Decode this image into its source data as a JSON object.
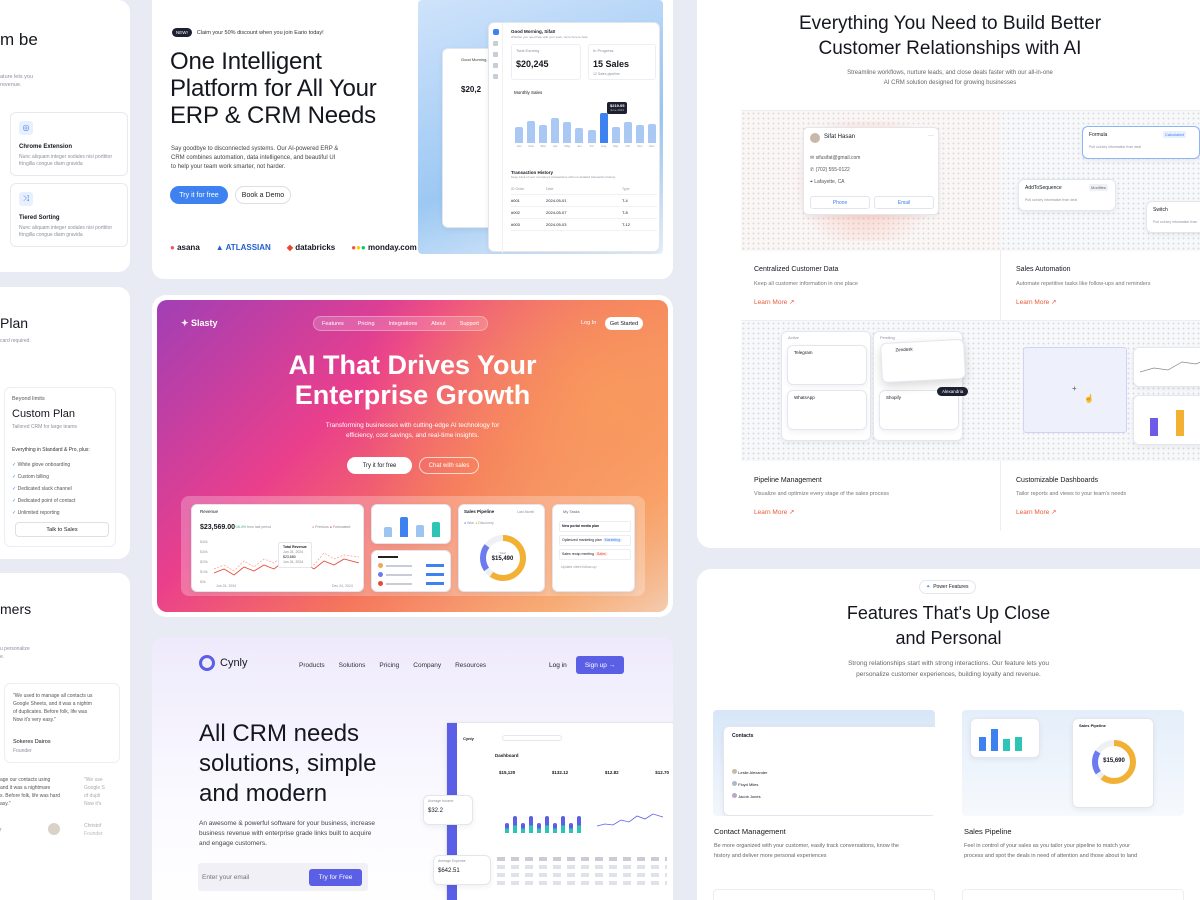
{
  "left_column": {
    "top": {
      "title_fragment": "m be",
      "text_lines": [
        "ature lets you",
        "revenue."
      ],
      "features": [
        {
          "title": "Chrome Extension",
          "desc_lines": [
            "Nunc aliquam integer sodales nisi porttitor",
            "fringilla congue diam gravida"
          ]
        },
        {
          "title": "Tiered Sorting",
          "desc_lines": [
            "Nunc aliquam integer sodales nisi porttitor",
            "fringilla congue diam gravida"
          ]
        }
      ]
    },
    "pricing": {
      "title_fragment": "Plan",
      "sub_fragment": "card required.",
      "eyebrow": "Beyond limits",
      "plan_name": "Custom Plan",
      "plan_desc": "Tailored CRM for large teams",
      "includes_label": "Everything in Standard & Pro, plus:",
      "items": [
        "White glove onboarding",
        "Custom billing",
        "Dedicated slack channel",
        "Dedicated point of contact",
        "Unlimited reporting"
      ],
      "cta": "Talk to Sales"
    },
    "testimonials": {
      "title_fragment": "mers",
      "sub_lines": [
        "u personalize",
        "e."
      ],
      "quote_lines": [
        "\"We used to manage all contacts us",
        "Google Sheets, and it was a nightm",
        "of duplicates. Before folk, life was",
        "Now it's very easy.\""
      ],
      "author": "Sokeres Dairos",
      "author_role": "Founder",
      "quote2_lines": [
        "age our contacts using",
        "and it was a nightmare",
        "s. Before folk, life was hard",
        "asy.\""
      ],
      "quote3_lines": [
        "\"We use",
        "Google S",
        "of dupli",
        "Now it's"
      ],
      "author3": "Christof",
      "role3": "Founder",
      "frag4": "r"
    }
  },
  "erp": {
    "badge": "NEW!",
    "announce": "Claim your 50% discount when you join Eario today!",
    "title_lines": [
      "One Intelligent",
      "Platform for All Your",
      "ERP & CRM Needs"
    ],
    "desc_lines": [
      "Say goodbye to disconnected systems. Our AI-powered ERP &",
      "CRM combines automation, data intelligence, and beautiful UI",
      "to help your team work smarter, not harder."
    ],
    "cta_primary": "Try it for free",
    "cta_secondary": "Book a Demo",
    "logos": [
      "asana",
      "ATLASSIAN",
      "databricks",
      "monday.com"
    ],
    "mockup": {
      "greeting": "Good Morning, Sifat!",
      "greeting_sub": "Whether you need help with your work, we're here to help",
      "total_earning_label": "Total Earning",
      "total_earning": "$20,245",
      "in_progress_label": "In Progress",
      "in_progress": "15 Sales",
      "in_progress_sub": "12 Sales pipeline",
      "monthly_sales": "Monthly Sales",
      "tooltip_value": "$219.05",
      "tooltip_sub": "June 2024",
      "bars": [
        0.55,
        0.75,
        0.6,
        0.85,
        0.7,
        0.5,
        0.45,
        1.0,
        0.55,
        0.7,
        0.6,
        0.65
      ],
      "months": [
        "Jan",
        "Feb",
        "Mar",
        "Apr",
        "May",
        "Jun",
        "Jul",
        "Aug",
        "Sep",
        "Oct",
        "Nov",
        "Dec"
      ],
      "tx_title": "Transaction History",
      "tx_sub": "Keep track of your company's transactions with our detailed transaction history.",
      "tx_headers": [
        "ID Order",
        "Date",
        "Type"
      ],
      "tx_rows": [
        [
          "#001",
          "2024-05-01",
          "T-4"
        ],
        [
          "#002",
          "2024-05-07",
          "T-8"
        ],
        [
          "#003",
          "2024-05-03",
          "T-12"
        ]
      ],
      "back_value": "$20,2"
    }
  },
  "slasty": {
    "logo": "Slasty",
    "nav": [
      "Features",
      "Pricing",
      "Integrations",
      "About",
      "Support"
    ],
    "login": "Log In",
    "get_started": "Get Started",
    "title_lines": [
      "AI That Drives Your",
      "Enterprise Growth"
    ],
    "desc_lines": [
      "Transforming businesses with cutting-edge AI technology for",
      "efficiency, cost savings, and real-time insights."
    ],
    "cta_primary": "Try it for free",
    "cta_secondary": "Chat with sales",
    "revenue_label": "Revenue",
    "revenue_value": "$23,569.00",
    "revenue_delta": "+16.4%",
    "revenue_delta_sub": "from last period",
    "legend_prev": "Previous",
    "legend_forecast": "Forecasted",
    "yticks": [
      "$40k",
      "$30k",
      "$20k",
      "$10k",
      "$0k"
    ],
    "date_start": "Jun 24, 2024",
    "date_end": "Dec 24, 2024",
    "tooltip_title": "Total Revenue",
    "tooltip_lines": [
      "Jun 24, 2024",
      "$23,680",
      "Jun 24, 2024"
    ],
    "pipeline_label": "Sales Pipeline",
    "pipeline_period": "Last Month",
    "pipeline_legend": [
      "Won",
      "Discovery"
    ],
    "pipeline_center_label": "Total",
    "pipeline_value": "$15,490",
    "tasks_label": "My Tasks",
    "tasks": [
      "New portal media plan",
      "Optimized marketing plan",
      "Sales recap meeting",
      "Update client follow-up"
    ],
    "task_tags": [
      "Marketing",
      "Sales"
    ]
  },
  "cynly": {
    "logo": "Cynly",
    "nav": [
      "Products",
      "Solutions",
      "Pricing",
      "Company",
      "Resources"
    ],
    "login": "Log in",
    "signup": "Sign up →",
    "title_lines": [
      "All CRM needs",
      "solutions, simple",
      "and modern"
    ],
    "desc_lines": [
      "An awesome & powerful software for your business, increase",
      "business revenue with enterprise grade links built to acquire",
      "and engage customers."
    ],
    "email_placeholder": "Enter your email",
    "cta": "Try for Free",
    "dash_title": "Dashboard",
    "stats": [
      "$15,120",
      "$132.12",
      "$12.82",
      "$12.70"
    ],
    "float1_label": "Average Income",
    "float1_value": "$32.2",
    "float2_label": "Average Expense",
    "float2_value": "$642.51"
  },
  "features_card": {
    "title_lines": [
      "Everything You Need to Build Better",
      "Customer Relationships with AI"
    ],
    "sub_lines": [
      "Streamline workflows, nurture leads, and close deals faster with our all-in-one",
      "AI CRM solution designed for growing businesses"
    ],
    "contact": {
      "name": "Sifat Hasan",
      "email": "sifusifat@gmail.com",
      "phone": "(702) 555-0122",
      "location": "Lafayette, CA",
      "btn_phone": "Phone",
      "btn_email": "Email"
    },
    "automation": {
      "formula": "Formula",
      "formula_tag": "Calculated",
      "formula_sub": "Pull out key information from deal",
      "add_label": "AddToSequence",
      "add_tag": "Modifies",
      "add_sub": "Pull out key information from deal",
      "switch_label": "Switch",
      "switch_sub": "Pull out key information from"
    },
    "pipeline_mock": {
      "col1": "Active",
      "col2": "Pending",
      "cards": [
        "Telegram",
        "WhatsApp",
        "Zendesk",
        "Shopify"
      ],
      "cursor_tag": "Alexandria"
    },
    "items": [
      {
        "title": "Centralized Customer Data",
        "desc": "Keep all customer information in one place",
        "link": "Learn More"
      },
      {
        "title": "Sales Automation",
        "desc": "Automate repetitive tasks like follow-ups and reminders",
        "link": "Learn More"
      },
      {
        "title": "Pipeline Management",
        "desc": "Visualize and optimize every stage of the sales process",
        "link": "Learn More"
      },
      {
        "title": "Customizable Dashboards",
        "desc": "Tailor reports and views to your team's needs",
        "link": "Learn More"
      }
    ]
  },
  "power_card": {
    "badge": "Power Features",
    "title_lines": [
      "Features That's Up Close",
      "and Personal"
    ],
    "sub_lines": [
      "Strong relationships start with strong interactions. Our feature lets you",
      "personalize customer experiences, building loyalty and revenue."
    ],
    "contacts_title": "Contacts",
    "contact_rows": [
      "Leslie Alexander",
      "Floyd Miles",
      "Jacob Jones"
    ],
    "pipeline_value": "$15,690",
    "pipeline_label": "Sales Pipeline",
    "items": [
      {
        "title": "Contact Management",
        "desc_lines": [
          "Be more organized with your customer, easily track conversations, know the",
          "history and deliver more personal experiences"
        ]
      },
      {
        "title": "Sales Pipeline",
        "desc_lines": [
          "Feel in control of your sales as you tailor your pipeline to match your",
          "process and spot the deals in need of attention and those about to land"
        ]
      }
    ]
  }
}
